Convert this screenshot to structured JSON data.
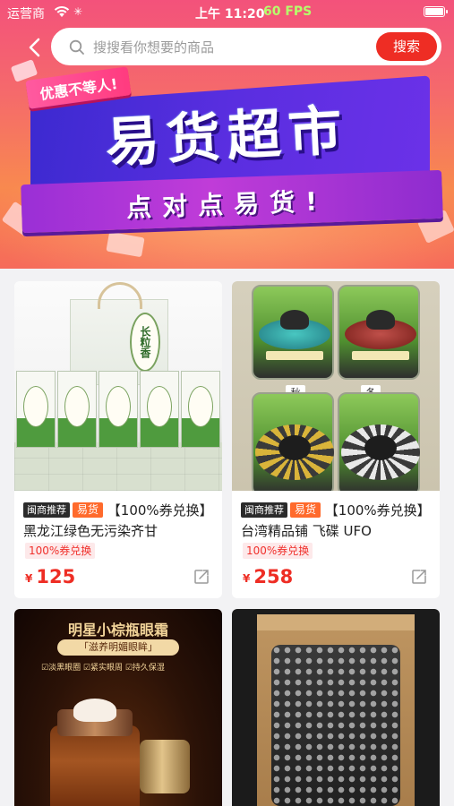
{
  "status_bar": {
    "carrier": "运营商",
    "time": "上午 11:20",
    "fps": "60 FPS"
  },
  "search": {
    "placeholder": "搜搜看你想要的商品",
    "button_label": "搜索"
  },
  "banner": {
    "tagline": "优惠不等人!",
    "title": "易货超市",
    "subtitle": "点对点易货!"
  },
  "products": [
    {
      "badge1": "闽商推荐",
      "badge2": "易货",
      "title": "【100%券兑换】黑龙江绿色无污染齐甘",
      "tag": "100%券兑换",
      "currency": "¥",
      "price": "125",
      "thumb_text": "长粒香"
    },
    {
      "badge1": "闽商推荐",
      "badge2": "易货",
      "title": "【100%券兑换】台湾精品铺 飞碟 UFO",
      "tag": "100%券兑换",
      "currency": "¥",
      "price": "258",
      "season_1": "秋",
      "season_2": "冬"
    },
    {
      "thumb_title": "明星小棕瓶眼霜",
      "thumb_subtitle": "「滋养明媚眼眸」",
      "thumb_ticks": "☑淡黑眼圈  ☑紧实眼周  ☑持久保湿"
    },
    {}
  ],
  "colors": {
    "accent_red": "#ee2d24",
    "badge_orange": "#ff6a2c",
    "banner_purple": "#5a2ee0"
  },
  "icons": {
    "back": "chevron-left-icon",
    "search": "search-icon",
    "share": "share-icon",
    "wifi": "wifi-icon",
    "battery": "battery-icon"
  }
}
